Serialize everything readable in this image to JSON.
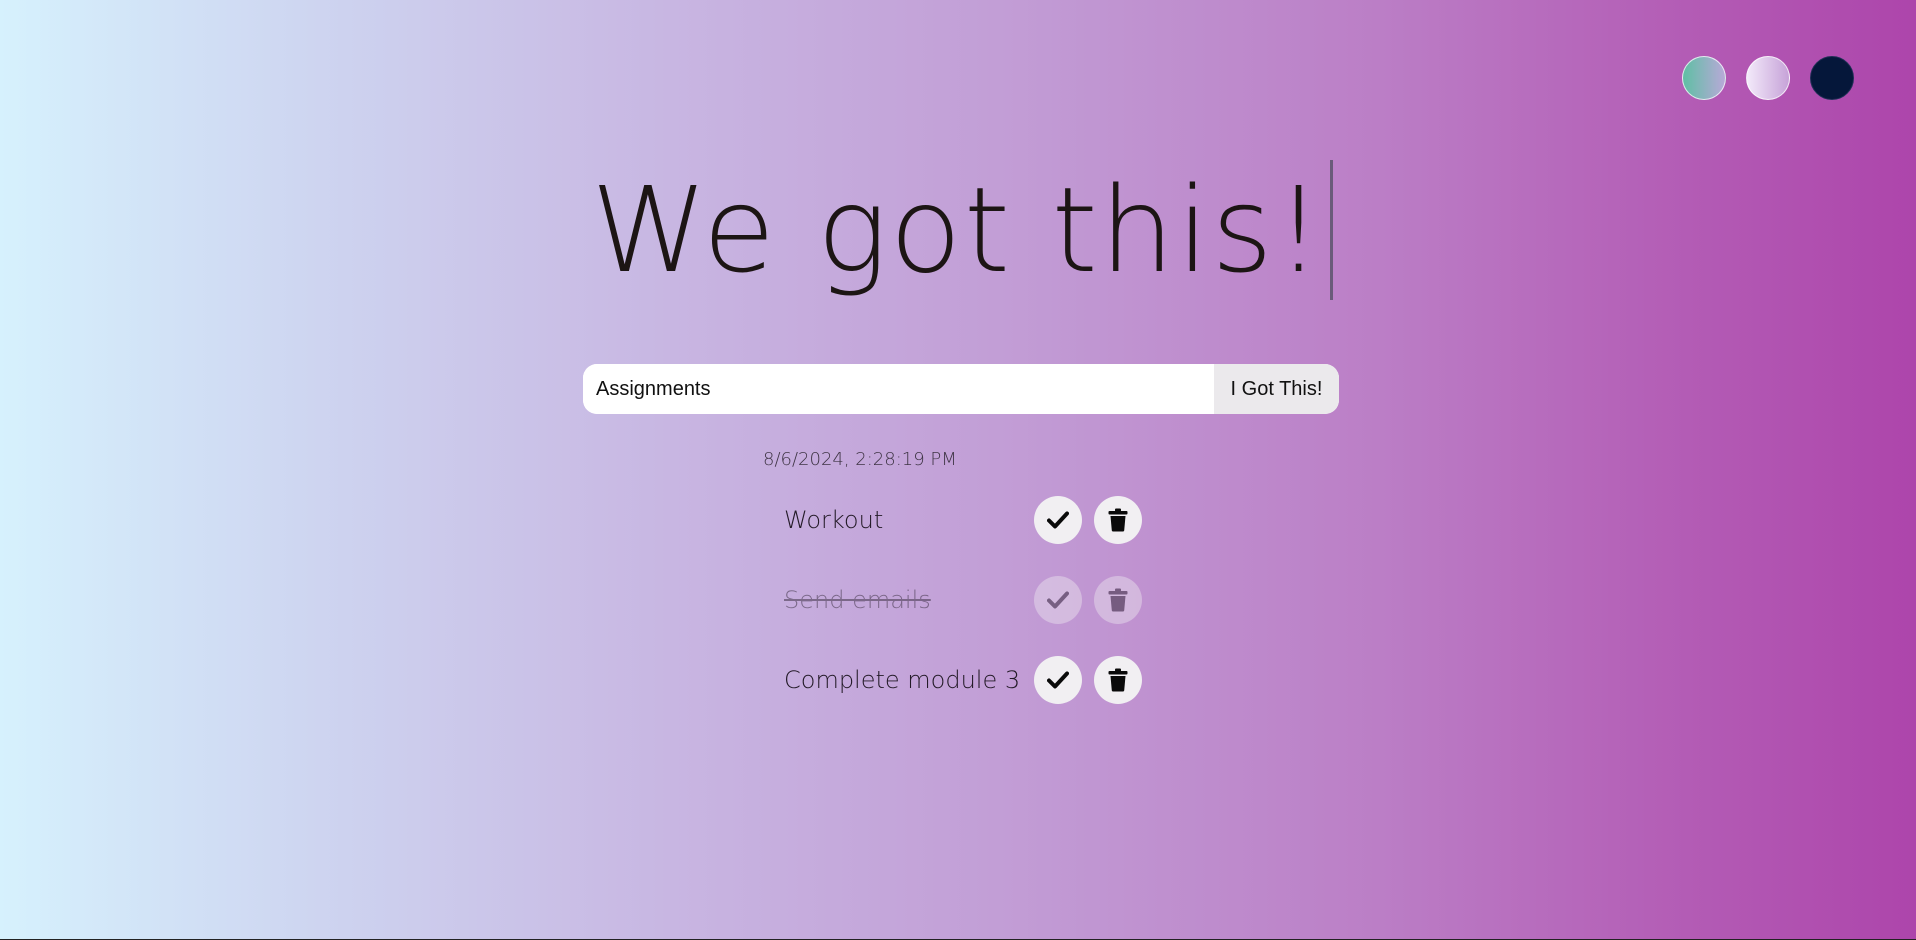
{
  "theme_selector": {
    "options": [
      {
        "name": "standard",
        "color_start": "#5fbfa4",
        "color_end": "#b8a9d8"
      },
      {
        "name": "light",
        "color_start": "#f3eafa",
        "color_end": "#c6a2d8"
      },
      {
        "name": "darker",
        "color": "#05173a"
      }
    ]
  },
  "header": {
    "title": "We got this!"
  },
  "form": {
    "input_value": "Assignments",
    "submit_label": "I Got This!"
  },
  "datetime": "8/6/2024, 2:28:19 PM",
  "todos": [
    {
      "text": "Workout",
      "completed": false
    },
    {
      "text": "Send emails",
      "completed": true
    },
    {
      "text": "Complete module 3",
      "completed": false
    }
  ],
  "icons": {
    "check": "check-icon",
    "delete": "trash-icon"
  },
  "colors": {
    "gradient_start": "#d6f1fd",
    "gradient_end": "#ad45ab",
    "text": "#1c1514"
  }
}
